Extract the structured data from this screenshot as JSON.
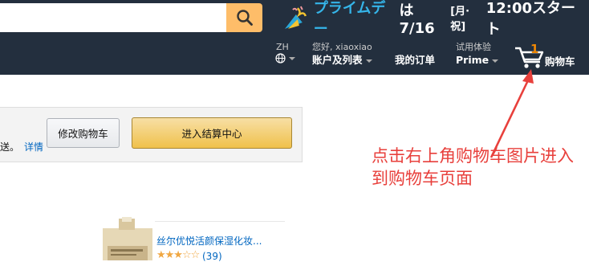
{
  "header": {
    "promo": {
      "brand": "プライムデー",
      "date_prefix": "は7/16",
      "date_bracket": "[月·祝]",
      "time_text": "12:00スタート"
    },
    "language": {
      "code": "ZH"
    },
    "account": {
      "greeting_prefix": "您好,",
      "username": "xiaoxiao",
      "label": "账户及列表"
    },
    "orders": {
      "label": "我的订单"
    },
    "prime": {
      "small": "试用体验",
      "label": "Prime"
    },
    "cart": {
      "count": "1",
      "label": "购物车"
    }
  },
  "cart_panel": {
    "note_text": "送。",
    "details_link": "详情",
    "edit_button": "修改购物车",
    "checkout_button": "进入结算中心"
  },
  "annotation": {
    "text": "点击右上角购物车图片进入到购物车页面",
    "color": "#e8403c"
  },
  "product": {
    "title": "丝尔优悦活颜保湿化妆...",
    "rating_stars": "★★★☆☆",
    "rating": 3,
    "reviews": "(39)"
  },
  "colors": {
    "nav_bg": "#232f3e",
    "search_button": "#febd69",
    "cart_count": "#f08804",
    "link": "#0066c0"
  }
}
